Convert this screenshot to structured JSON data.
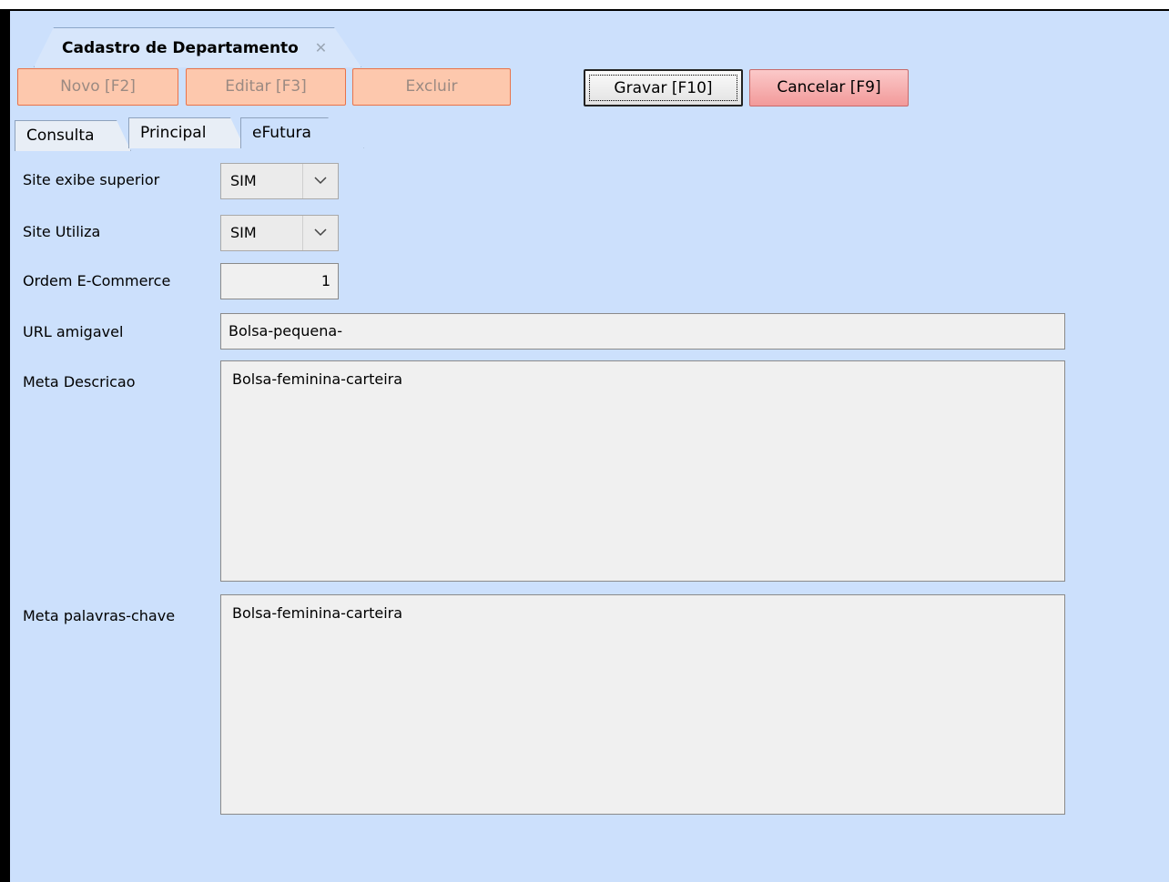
{
  "document_tab": {
    "title": "Cadastro de Departamento",
    "close_glyph": "✕"
  },
  "toolbar": {
    "novo": "Novo [F2]",
    "editar": "Editar [F3]",
    "excluir": "Excluir",
    "gravar": "Gravar [F10]",
    "cancelar": "Cancelar [F9]"
  },
  "tabs": [
    "Consulta",
    "Principal",
    "eFutura"
  ],
  "active_tab": "eFutura",
  "form": {
    "site_exibe_superior": {
      "label": "Site exibe superior",
      "value": "SIM"
    },
    "site_utiliza": {
      "label": "Site Utiliza",
      "value": "SIM"
    },
    "ordem_ecommerce": {
      "label": "Ordem E-Commerce",
      "value": "1"
    },
    "url_amigavel": {
      "label": "URL amigavel",
      "value": "Bolsa-pequena-"
    },
    "meta_descricao": {
      "label": "Meta Descricao",
      "value": "Bolsa-feminina-carteira"
    },
    "meta_palavras_chave": {
      "label": "Meta palavras-chave",
      "value": "Bolsa-feminina-carteira"
    }
  },
  "colors": {
    "background": "#cce0fc",
    "disabled_button": "#fdc8ad",
    "cancel_button": "#f29a9a"
  },
  "icons": {
    "dropdown": "chevron-down-icon",
    "close": "close-icon"
  }
}
